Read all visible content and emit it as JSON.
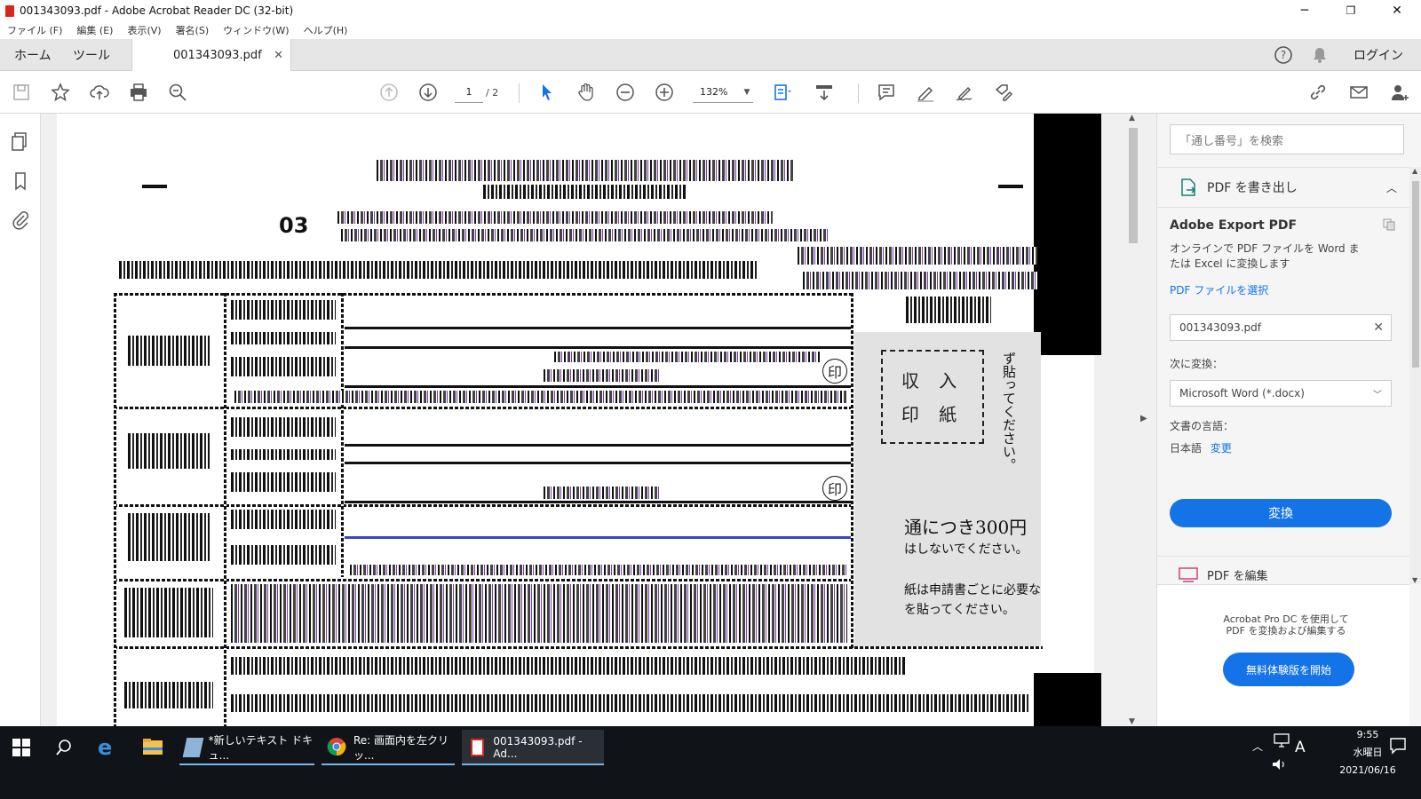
{
  "window": {
    "title": "001343093.pdf - Adobe Acrobat Reader DC (32-bit)",
    "minimize": "─",
    "maximize": "❐",
    "close": "✕"
  },
  "menu": [
    "ファイル (F)",
    "編集 (E)",
    "表示(V)",
    "署名(S)",
    "ウィンドウ(W)",
    "ヘルプ(H)"
  ],
  "tabs": {
    "home": "ホーム",
    "tools": "ツール",
    "document": "001343093.pdf",
    "login": "ログイン"
  },
  "toolbar": {
    "page_current": "1",
    "page_total": "/ 2",
    "zoom": "132%"
  },
  "document": {
    "stamp_line1": "収 入",
    "stamp_line2": "印 紙",
    "side_text": "ず貼ってください。",
    "fee_text": "通につき300円",
    "note1": "はしないでください。",
    "note2": "紙は申請書ごとに必要な",
    "note3": "を貼ってください。",
    "seal": "印",
    "code": "03"
  },
  "right_panel": {
    "search_placeholder": "「通し番号」を検索",
    "export_header": "PDF を書き出し",
    "export_title": "Adobe Export PDF",
    "export_desc": "オンラインで PDF ファイルを Word または Excel に変換します",
    "select_file_link": "PDF ファイルを選択",
    "selected_file": "001343093.pdf",
    "convert_to_label": "次に変換：",
    "convert_format": "Microsoft Word (*.docx)",
    "language_label": "文書の言語：",
    "language_value": "日本語",
    "language_change": "変更",
    "convert_button": "変換",
    "edit_pdf": "PDF を編集",
    "pro_text": "Acrobat Pro DC を使用して PDF を変換および編集する",
    "trial_button": "無料体験版を開始"
  },
  "taskbar": {
    "items": [
      "*新しいテキスト ドキュ...",
      "Re: 画面内を左クリッ...",
      "001343093.pdf - Ad..."
    ],
    "ime": "A",
    "time": "9:55",
    "weekday": "水曜日",
    "date": "2021/06/16"
  },
  "colors": {
    "accent": "#1473e6",
    "pdf_red": "#d9261c",
    "taskbar": "#101418"
  }
}
